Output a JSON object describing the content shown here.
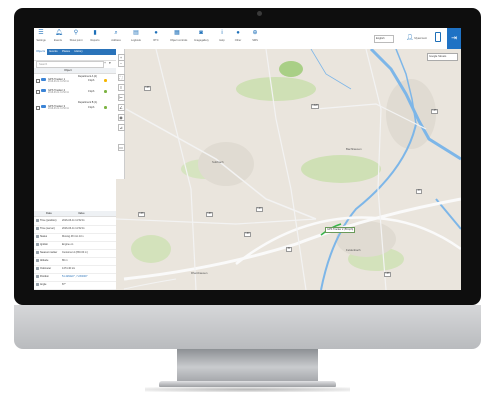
{
  "toolbar": {
    "items": [
      {
        "label": "Settings",
        "icon": "hamburger-icon"
      },
      {
        "label": "Events",
        "icon": "bell-icon"
      },
      {
        "label": "Show point",
        "icon": "map-pin-icon"
      },
      {
        "label": "Reports",
        "icon": "chart-icon"
      },
      {
        "label": "Address",
        "icon": "search-icon"
      },
      {
        "label": "Logbook",
        "icon": "book-icon"
      },
      {
        "label": "RTC",
        "icon": "chat-icon"
      },
      {
        "label": "Object controls",
        "icon": "calendar-icon"
      },
      {
        "label": "Imagegallery",
        "icon": "camera-icon"
      },
      {
        "label": "Help",
        "icon": "info-icon"
      },
      {
        "label": "Other",
        "icon": "other-icon"
      },
      {
        "label": "SMS",
        "icon": "sms-icon"
      }
    ],
    "language": "English",
    "user": "Myaccount",
    "accent": "#1d6fb8"
  },
  "panel": {
    "tabs": [
      "Objects",
      "Events",
      "Places",
      "History"
    ],
    "active_tab": "Objects",
    "search_placeholder": "Search",
    "list_header": "Object",
    "objects": [
      {
        "name": "GPS Tracker 1",
        "sub": "2016-03-11 11:52:11",
        "speed": "0 kph",
        "group": "Department A (2)",
        "status_color": "#f5b500"
      },
      {
        "name": "GPS Tracker 2",
        "sub": "2016-03-11 11:52:11",
        "speed": "0 kph",
        "group": "",
        "status_color": "#7cb342"
      },
      {
        "name": "GPS Tracker 3",
        "sub": "2016-03-11 11:52:11",
        "speed": "0 kph",
        "group": "Department B (1)",
        "status_color": "#7cb342"
      }
    ],
    "detail_header": {
      "data": "Data",
      "value": "Value"
    },
    "details": [
      {
        "key": "Time (position)",
        "value": "2016-03-11 11:52:11"
      },
      {
        "key": "Time (server)",
        "value": "2016-03-11 11:52:11"
      },
      {
        "key": "Status",
        "value": "Moving 48 min 10 s"
      },
      {
        "key": "Ignition",
        "value": "Engine on"
      },
      {
        "key": "Nearest marker",
        "value": "Customer A (830.00 m)"
      },
      {
        "key": "Altitude",
        "value": "86 m"
      },
      {
        "key": "Odometer",
        "value": "1474.40 km"
      },
      {
        "key": "Position",
        "value": "51.426222°, 7.230000°",
        "link": true
      },
      {
        "key": "Angle",
        "value": "87°"
      }
    ]
  },
  "map": {
    "layer_select": "Google Streets",
    "places": [
      "Sulzbach",
      "Bachhausen",
      "Rheinhausen",
      "Feldenbach"
    ],
    "road_labels": [
      "L36",
      "L328",
      "L35",
      "L88",
      "L23",
      "A1",
      "A3",
      "L36",
      "L69",
      "L36"
    ],
    "vehicle_label": "GPS Tracker 2 (59 kph)",
    "route_color": "#39b54a",
    "water_color": "#7db6e8"
  }
}
